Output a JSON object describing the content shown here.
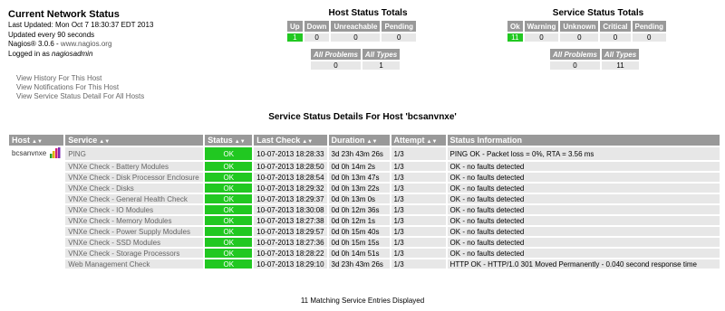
{
  "header": {
    "title": "Current Network Status",
    "last_updated": "Last Updated: Mon Oct 7 18:30:37 EDT 2013",
    "update_interval": "Updated every 90 seconds",
    "version": "Nagios® 3.0.6 - ",
    "site": "www.nagios.org",
    "logged_in_prefix": "Logged in as ",
    "user": "nagiosadmin"
  },
  "links": [
    "View History For This Host",
    "View Notifications For This Host",
    "View Service Status Detail For All Hosts"
  ],
  "host_totals": {
    "title": "Host Status Totals",
    "headers": [
      "Up",
      "Down",
      "Unreachable",
      "Pending"
    ],
    "values": [
      "1",
      "0",
      "0",
      "0"
    ],
    "summary_headers": [
      "All Problems",
      "All Types"
    ],
    "summary_values": [
      "0",
      "1"
    ]
  },
  "service_totals": {
    "title": "Service Status Totals",
    "headers": [
      "Ok",
      "Warning",
      "Unknown",
      "Critical",
      "Pending"
    ],
    "values": [
      "11",
      "0",
      "0",
      "0",
      "0"
    ],
    "summary_headers": [
      "All Problems",
      "All Types"
    ],
    "summary_values": [
      "0",
      "11"
    ]
  },
  "details": {
    "title": "Service Status Details For Host 'bcsanvnxe'",
    "columns": [
      "Host",
      "Service",
      "Status",
      "Last Check",
      "Duration",
      "Attempt",
      "Status Information"
    ],
    "host": "bcsanvnxe",
    "rows": [
      {
        "service": "PING",
        "status": "OK",
        "last_check": "10-07-2013 18:28:33",
        "duration": "3d 23h 43m 26s",
        "attempt": "1/3",
        "info": "PING OK - Packet loss = 0%, RTA = 3.56 ms"
      },
      {
        "service": "VNXe Check - Battery Modules",
        "status": "OK",
        "last_check": "10-07-2013 18:28:50",
        "duration": "0d 0h 14m 2s",
        "attempt": "1/3",
        "info": "OK - no faults detected"
      },
      {
        "service": "VNXe Check - Disk Processor Enclosure",
        "status": "OK",
        "last_check": "10-07-2013 18:28:54",
        "duration": "0d 0h 13m 47s",
        "attempt": "1/3",
        "info": "OK - no faults detected"
      },
      {
        "service": "VNXe Check - Disks",
        "status": "OK",
        "last_check": "10-07-2013 18:29:32",
        "duration": "0d 0h 13m 22s",
        "attempt": "1/3",
        "info": "OK - no faults detected"
      },
      {
        "service": "VNXe Check - General Health Check",
        "status": "OK",
        "last_check": "10-07-2013 18:29:37",
        "duration": "0d 0h 13m 0s",
        "attempt": "1/3",
        "info": "OK - no faults detected"
      },
      {
        "service": "VNXe Check - IO Modules",
        "status": "OK",
        "last_check": "10-07-2013 18:30:08",
        "duration": "0d 0h 12m 36s",
        "attempt": "1/3",
        "info": "OK - no faults detected"
      },
      {
        "service": "VNXe Check - Memory Modules",
        "status": "OK",
        "last_check": "10-07-2013 18:27:38",
        "duration": "0d 0h 12m 1s",
        "attempt": "1/3",
        "info": "OK - no faults detected"
      },
      {
        "service": "VNXe Check - Power Supply Modules",
        "status": "OK",
        "last_check": "10-07-2013 18:29:57",
        "duration": "0d 0h 15m 40s",
        "attempt": "1/3",
        "info": "OK - no faults detected"
      },
      {
        "service": "VNXe Check - SSD Modules",
        "status": "OK",
        "last_check": "10-07-2013 18:27:36",
        "duration": "0d 0h 15m 15s",
        "attempt": "1/3",
        "info": "OK - no faults detected"
      },
      {
        "service": "VNXe Check - Storage Processors",
        "status": "OK",
        "last_check": "10-07-2013 18:28:22",
        "duration": "0d 0h 14m 51s",
        "attempt": "1/3",
        "info": "OK - no faults detected"
      },
      {
        "service": "Web Management Check",
        "status": "OK",
        "last_check": "10-07-2013 18:29:10",
        "duration": "3d 23h 43m 26s",
        "attempt": "1/3",
        "info": "HTTP OK - HTTP/1.0 301 Moved Permanently - 0.040 second response time"
      }
    ]
  },
  "footer": "11 Matching Service Entries Displayed",
  "colors": {
    "ok": "#21c821",
    "header": "#999999",
    "cell": "#e7e7e7"
  },
  "icons": {
    "sort": "sort-arrows-icon",
    "host_status": "bars-icon"
  }
}
